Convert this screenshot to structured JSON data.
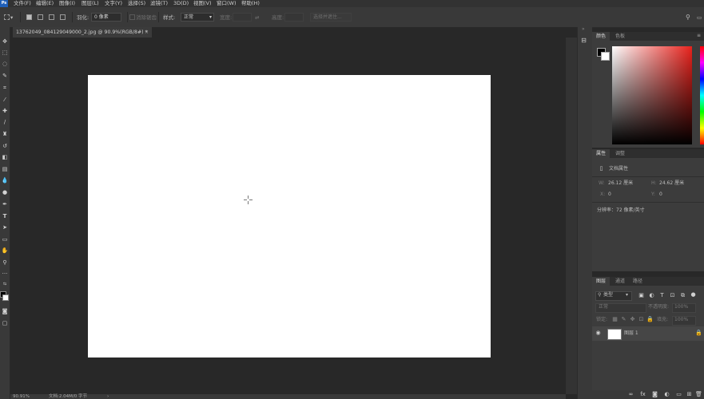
{
  "menu": [
    "文件(F)",
    "编辑(E)",
    "图像(I)",
    "图层(L)",
    "文字(Y)",
    "选择(S)",
    "滤镜(T)",
    "3D(D)",
    "视图(V)",
    "窗口(W)",
    "帮助(H)"
  ],
  "app_badge": "Ps",
  "options": {
    "feather_label": "羽化:",
    "feather_value": "0 像素",
    "antialias_label": "消除锯齿",
    "style_label": "样式:",
    "style_value": "正常",
    "width_label": "宽度:",
    "height_label": "高度:",
    "select_mask": "选择并遮住..."
  },
  "document": {
    "tab_title": "13762049_084129049000_2.jpg @ 90.9%(RGB/8#) *",
    "close": "×"
  },
  "status": {
    "zoom": "90.91%",
    "doc_info": "文档:2.04M/0 字节"
  },
  "color_panel": {
    "tabs": [
      "颜色",
      "色板"
    ],
    "foreground": "#000000",
    "background": "#ffffff"
  },
  "properties_panel": {
    "tabs": [
      "属性",
      "调整"
    ],
    "doc_props_label": "文档属性",
    "w_label": "W:",
    "w_value": "26.12 厘米",
    "h_label": "H:",
    "h_value": "24.62 厘米",
    "x_label": "X:",
    "x_value": "0",
    "y_label": "Y:",
    "y_value": "0",
    "resolution": "分辨率：72 像素/英寸"
  },
  "layers_panel": {
    "tabs": [
      "图层",
      "通道",
      "路径"
    ],
    "kind": "类型",
    "blend_mode": "正常",
    "opacity_label": "不透明度:",
    "opacity_value": "100%",
    "lock_label": "锁定:",
    "fill_label": "填充:",
    "fill_value": "100%",
    "layers": [
      {
        "name": "图层 1",
        "visible": true,
        "locked": true
      }
    ]
  }
}
